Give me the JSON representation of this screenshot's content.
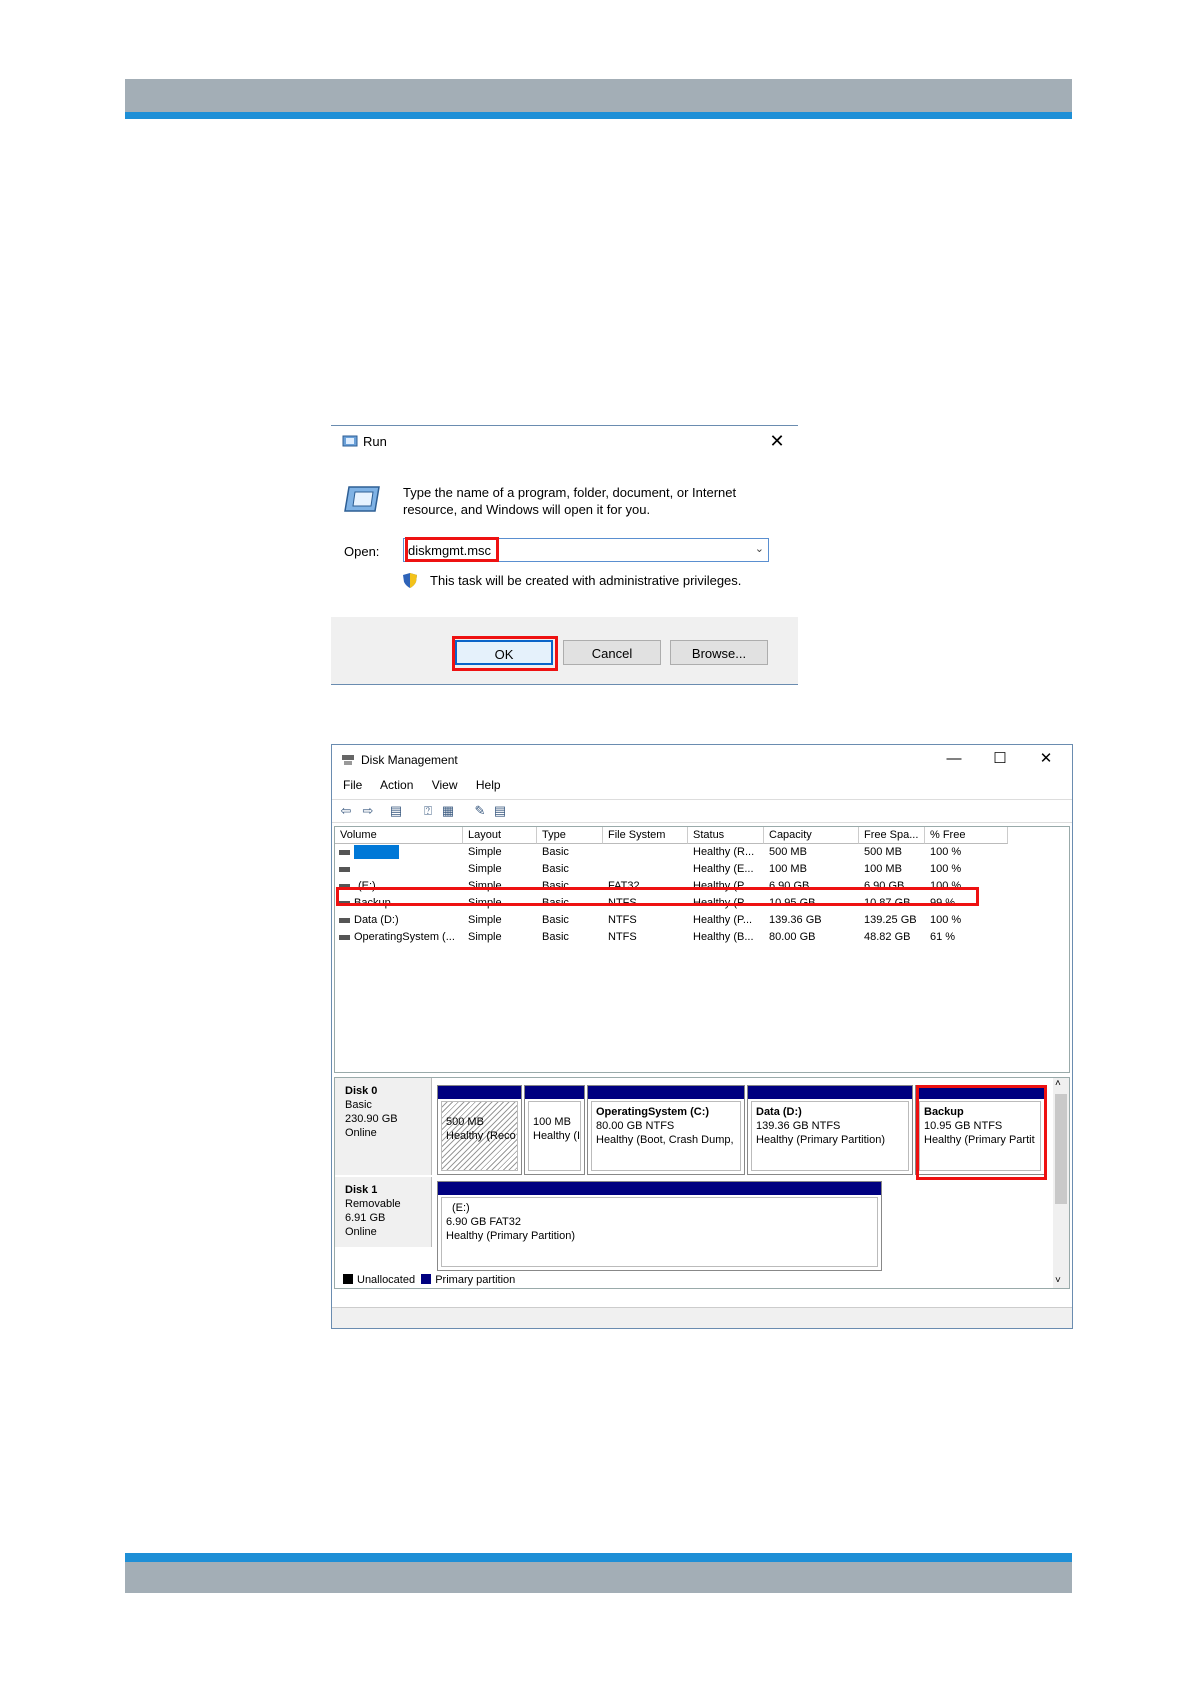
{
  "run_dialog": {
    "title": "Run",
    "close": "✕",
    "description": "Type the name of a program, folder, document, or Internet resource, and Windows will open it for you.",
    "open_label": "Open:",
    "open_value": "diskmgmt.msc",
    "admin_note": "This task will be created with administrative privileges.",
    "ok": "OK",
    "cancel": "Cancel",
    "browse": "Browse..."
  },
  "disk_management": {
    "title": "Disk Management",
    "menu": [
      "File",
      "Action",
      "View",
      "Help"
    ],
    "columns": [
      "Volume",
      "Layout",
      "Type",
      "File System",
      "Status",
      "Capacity",
      "Free Spa...",
      "% Free"
    ],
    "rows": [
      {
        "volume": "",
        "layout": "Simple",
        "type": "Basic",
        "fs": "",
        "status": "Healthy (R...",
        "capacity": "500 MB",
        "free": "500 MB",
        "pct": "100 %"
      },
      {
        "volume": "",
        "layout": "Simple",
        "type": "Basic",
        "fs": "",
        "status": "Healthy (E...",
        "capacity": "100 MB",
        "free": "100 MB",
        "pct": "100 %"
      },
      {
        "volume": "(E:)",
        "layout": "Simple",
        "type": "Basic",
        "fs": "FAT32",
        "status": "Healthy (P...",
        "capacity": "6.90 GB",
        "free": "6.90 GB",
        "pct": "100 %"
      },
      {
        "volume": "Backup",
        "layout": "Simple",
        "type": "Basic",
        "fs": "NTFS",
        "status": "Healthy (P...",
        "capacity": "10.95 GB",
        "free": "10.87 GB",
        "pct": "99 %"
      },
      {
        "volume": "Data (D:)",
        "layout": "Simple",
        "type": "Basic",
        "fs": "NTFS",
        "status": "Healthy (P...",
        "capacity": "139.36 GB",
        "free": "139.25 GB",
        "pct": "100 %"
      },
      {
        "volume": "OperatingSystem (...",
        "layout": "Simple",
        "type": "Basic",
        "fs": "NTFS",
        "status": "Healthy (B...",
        "capacity": "80.00 GB",
        "free": "48.82 GB",
        "pct": "61 %"
      }
    ],
    "disks": [
      {
        "name": "Disk 0",
        "kind": "Basic",
        "size": "230.90 GB",
        "state": "Online",
        "partitions": [
          {
            "title": "",
            "line1": "500 MB",
            "line2": "Healthy (Reco"
          },
          {
            "title": "",
            "line1": "100 MB",
            "line2": "Healthy (I"
          },
          {
            "title": "OperatingSystem  (C:)",
            "line1": "80.00 GB NTFS",
            "line2": "Healthy (Boot, Crash Dump,"
          },
          {
            "title": "Data  (D:)",
            "line1": "139.36 GB NTFS",
            "line2": "Healthy (Primary Partition)"
          },
          {
            "title": "Backup",
            "line1": "10.95 GB NTFS",
            "line2": "Healthy (Primary Partit"
          }
        ]
      },
      {
        "name": "Disk 1",
        "kind": "Removable",
        "size": "6.91 GB",
        "state": "Online",
        "partitions": [
          {
            "title": "(E:)",
            "line1": "6.90 GB FAT32",
            "line2": "Healthy (Primary Partition)"
          }
        ]
      }
    ],
    "legend": [
      "Unallocated",
      "Primary partition"
    ],
    "colors": {
      "primary": "#000080",
      "unallocated": "#000000",
      "highlight": "#e11111"
    }
  }
}
